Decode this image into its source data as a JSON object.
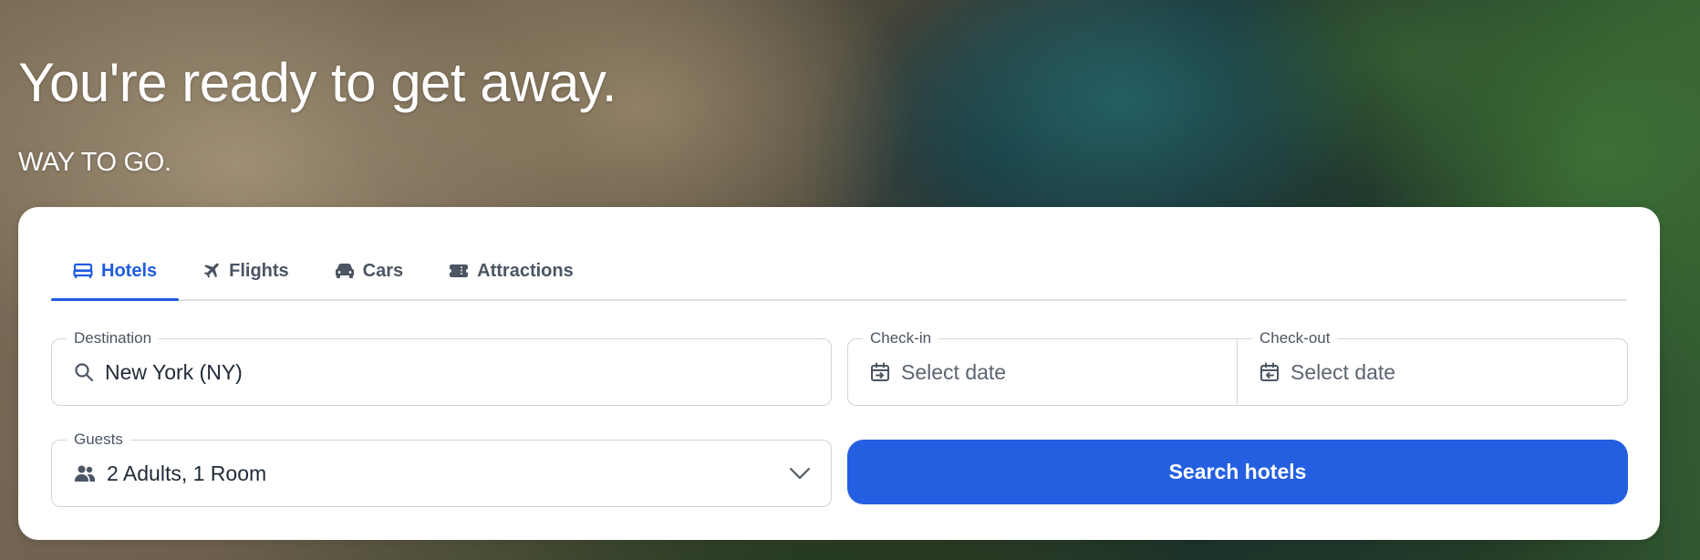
{
  "hero": {
    "title": "You're ready to get away.",
    "subtitle": "WAY TO GO."
  },
  "tabs": [
    {
      "label": "Hotels",
      "icon": "bed-icon",
      "active": true
    },
    {
      "label": "Flights",
      "icon": "plane-icon",
      "active": false
    },
    {
      "label": "Cars",
      "icon": "car-icon",
      "active": false
    },
    {
      "label": "Attractions",
      "icon": "ticket-icon",
      "active": false
    }
  ],
  "destination": {
    "label": "Destination",
    "value": "New York (NY)",
    "icon": "search-icon"
  },
  "checkin": {
    "label": "Check-in",
    "placeholder": "Select date",
    "icon": "calendar-checkin-icon"
  },
  "checkout": {
    "label": "Check-out",
    "placeholder": "Select date",
    "icon": "calendar-checkout-icon"
  },
  "guests": {
    "label": "Guests",
    "value": "2 Adults, 1 Room",
    "icon": "people-icon",
    "dropdown_icon": "chevron-down-icon"
  },
  "search_button": {
    "label": "Search hotels"
  },
  "colors": {
    "accent": "#235fe0",
    "active_tab": "#1f5ce0",
    "tab_text": "#4b5563",
    "border": "#cfd5dc",
    "card_bg": "#ffffff"
  }
}
